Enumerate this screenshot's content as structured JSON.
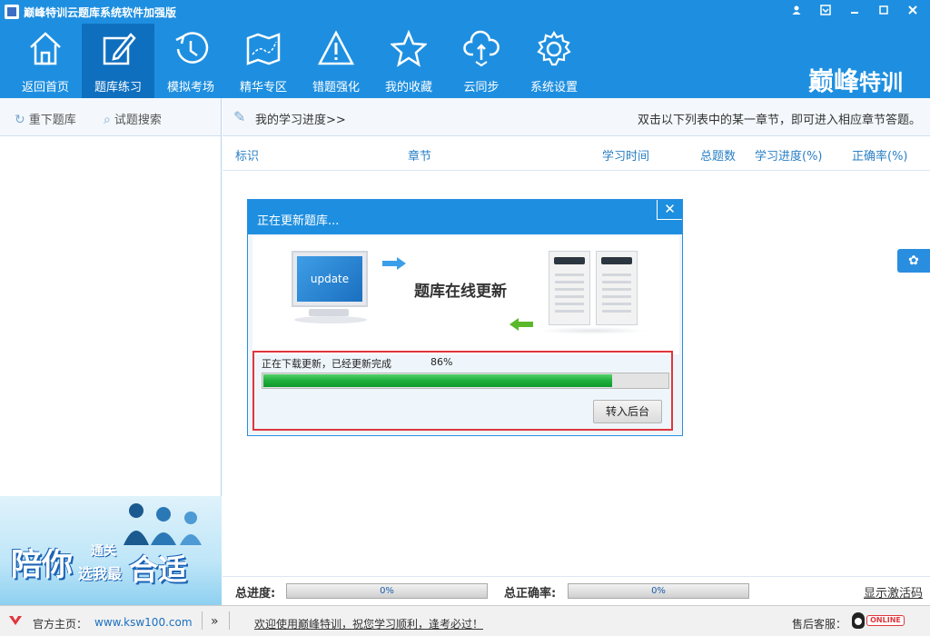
{
  "window": {
    "title": "巅峰特训云题库系统软件加强版",
    "controls": [
      "user-icon",
      "menu-icon",
      "minimize-icon",
      "maximize-icon",
      "close-icon"
    ]
  },
  "toolbar": {
    "items": [
      {
        "label": "返回首页",
        "icon": "home-icon",
        "active": false
      },
      {
        "label": "题库练习",
        "icon": "edit-icon",
        "active": true
      },
      {
        "label": "模拟考场",
        "icon": "clock-icon",
        "active": false
      },
      {
        "label": "精华专区",
        "icon": "map-icon",
        "active": false
      },
      {
        "label": "错题强化",
        "icon": "warning-icon",
        "active": false
      },
      {
        "label": "我的收藏",
        "icon": "star-icon",
        "active": false
      },
      {
        "label": "云同步",
        "icon": "cloud-sync-icon",
        "active": false
      },
      {
        "label": "系统设置",
        "icon": "gear-icon",
        "active": false
      }
    ],
    "brand_main": "巅峰",
    "brand_sub": "特训"
  },
  "left": {
    "reload_label": "重下题库",
    "search_label": "试题搜索",
    "banner": {
      "line1": "陪你",
      "line2": "通关",
      "line3": "选我最",
      "line4": "合适"
    }
  },
  "main": {
    "progress_title": "我的学习进度>>",
    "hint": "双击以下列表中的某一章节，即可进入相应章节答题。",
    "columns": [
      "标识",
      "章节",
      "学习时间",
      "总题数",
      "学习进度(%)",
      "正确率(%)"
    ]
  },
  "dialog": {
    "title": "正在更新题库...",
    "monitor_text": "update",
    "illus_text": "题库在线更新",
    "status": "正在下载更新，已经更新完成",
    "percent_text": "86%",
    "progress": 0.86,
    "background_button": "转入后台"
  },
  "stats": {
    "total_progress_label": "总进度:",
    "total_progress_value": "0%",
    "total_accuracy_label": "总正确率:",
    "total_accuracy_value": "0%",
    "activate_label": "显示激活码"
  },
  "statusbar": {
    "home_label": "官方主页：",
    "home_url": "www.ksw100.com",
    "double_arrow": "»",
    "welcome": "欢迎使用巅峰特训，祝您学习顺利，逢考必过！",
    "support_label": "售后客服：",
    "online_badge": "ONLINE"
  },
  "colors": {
    "primary": "#1e8fe0",
    "active_tab": "#0f6fbf",
    "progress_green": "#1fae3b",
    "highlight_red": "#e0363d"
  }
}
